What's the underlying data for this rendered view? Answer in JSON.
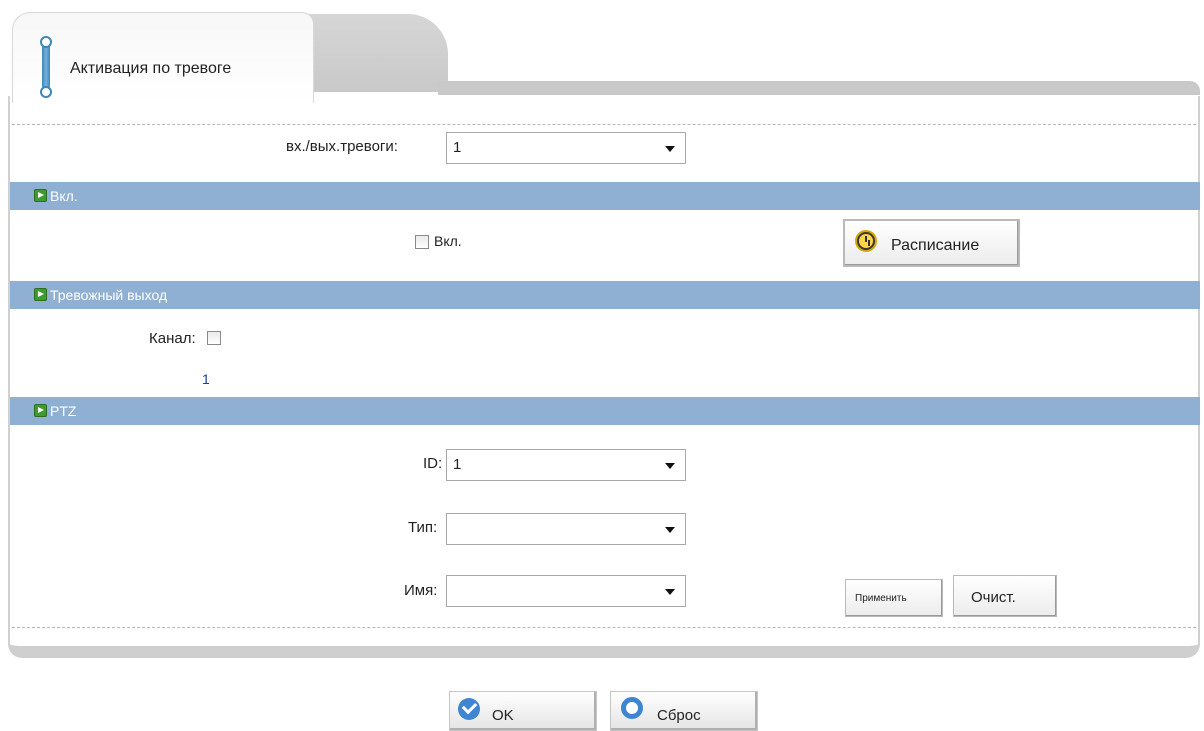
{
  "tab": {
    "label": "Активация по тревоге"
  },
  "alarm_io": {
    "label": "вх./вых.тревоги:",
    "value": "1"
  },
  "sections": {
    "enable": {
      "title": "Вкл.",
      "checkbox_label": "Вкл.",
      "checked": false,
      "schedule_label": "Расписание"
    },
    "alarm_output": {
      "title": "Тревожный выход",
      "channel_label": "Канал:",
      "channel_checked": false,
      "channel_number": "1"
    },
    "ptz": {
      "title": "PTZ",
      "id_label": "ID:",
      "id_value": "1",
      "type_label": "Тип:",
      "type_value": "",
      "name_label": "Имя:",
      "name_value": "",
      "apply_label": "Применить",
      "clear_label": "Очист."
    }
  },
  "footer": {
    "ok_label": "OK",
    "reset_label": "Сброс"
  },
  "colors": {
    "section_header": "#8fb0d3",
    "accent_blue": "#3f86d2",
    "section_icon": "#3f9a2f"
  }
}
